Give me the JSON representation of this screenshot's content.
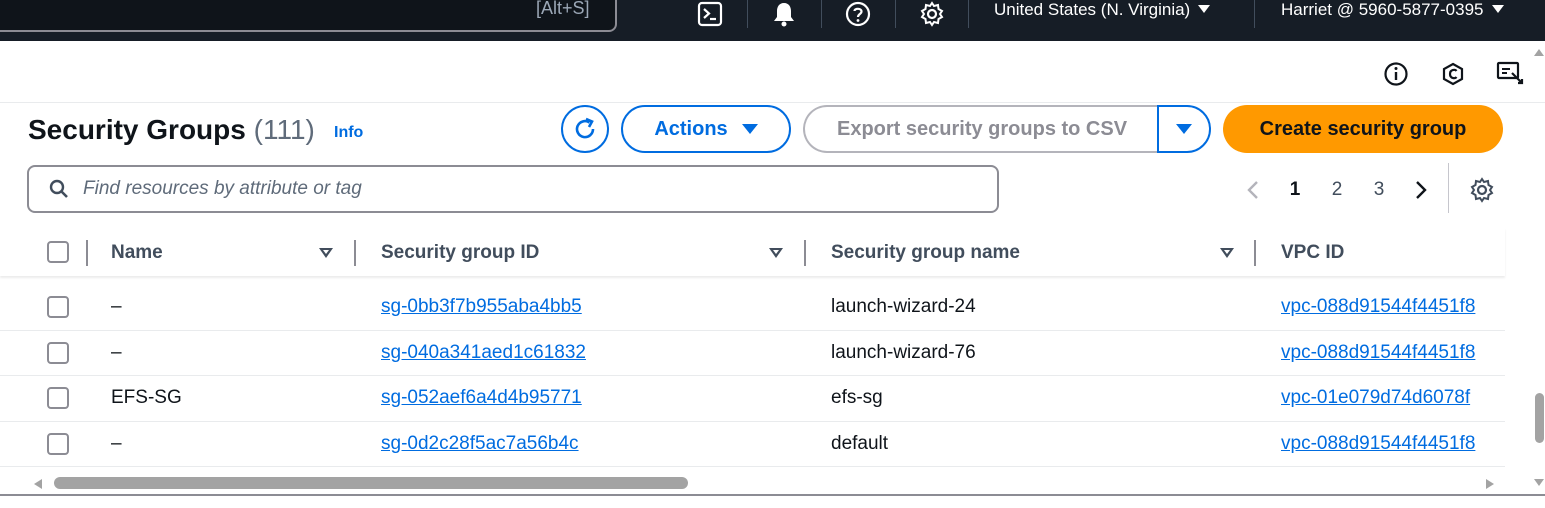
{
  "topbar": {
    "search_shortcut": "[Alt+S]",
    "region": "United States (N. Virginia)",
    "account": "Harriet @ 5960-5877-0395",
    "icons": [
      "cloudshell-icon",
      "bell-icon",
      "help-icon",
      "settings-icon"
    ]
  },
  "header": {
    "title": "Security Groups",
    "count": "(111)",
    "info": "Info"
  },
  "buttons": {
    "refresh": "refresh-icon",
    "actions": "Actions",
    "export": "Export security groups to CSV",
    "create": "Create security group"
  },
  "filter": {
    "placeholder": "Find resources by attribute or tag"
  },
  "pagination": {
    "pages": [
      "1",
      "2",
      "3"
    ],
    "current": "1"
  },
  "table": {
    "columns": [
      "Name",
      "Security group ID",
      "Security group name",
      "VPC ID"
    ],
    "rows": [
      {
        "name": "–",
        "sg_id": "sg-0bb3f7b955aba4bb5",
        "sg_name": "launch-wizard-24",
        "vpc_id": "vpc-088d91544f4451f8"
      },
      {
        "name": "–",
        "sg_id": "sg-040a341aed1c61832",
        "sg_name": "launch-wizard-76",
        "vpc_id": "vpc-088d91544f4451f8"
      },
      {
        "name": "EFS-SG",
        "sg_id": "sg-052aef6a4d4b95771",
        "sg_name": "efs-sg",
        "vpc_id": "vpc-01e079d74d6078f"
      },
      {
        "name": "–",
        "sg_id": "sg-0d2c28f5ac7a56b4c",
        "sg_name": "default",
        "vpc_id": "vpc-088d91544f4451f8"
      }
    ]
  },
  "colors": {
    "topbar_bg": "#161d26",
    "link": "#006ce0",
    "primary_button": "#ff9900",
    "border": "#8c8c94"
  }
}
